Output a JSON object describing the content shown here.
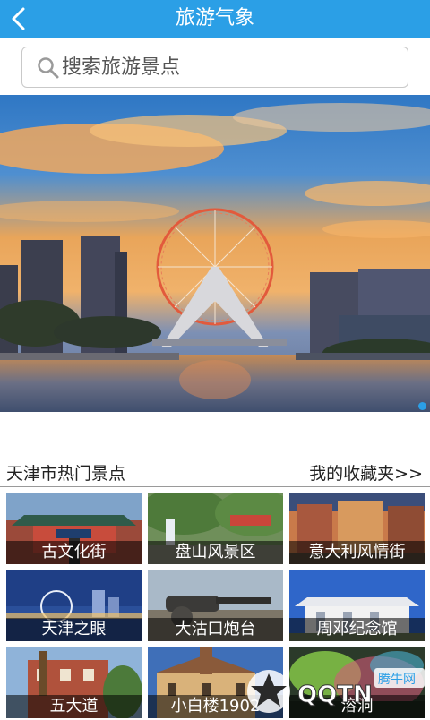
{
  "header": {
    "title": "旅游气象"
  },
  "search": {
    "placeholder": "搜索旅游景点"
  },
  "section": {
    "title": "天津市热门景点",
    "favorites_link": "我的收藏夹>>"
  },
  "spots": [
    {
      "name": "古文化街"
    },
    {
      "name": "盘山风景区"
    },
    {
      "name": "意大利风情街"
    },
    {
      "name": "天津之眼"
    },
    {
      "name": "大沽口炮台"
    },
    {
      "name": "周邓纪念馆"
    },
    {
      "name": "五大道"
    },
    {
      "name": "小白楼1902"
    },
    {
      "name": "溶洞"
    }
  ],
  "watermark": {
    "site": "QQTN",
    "badge": "腾牛网"
  },
  "colors": {
    "header": "#2b9fe6",
    "accent": "#2b9fe6"
  }
}
